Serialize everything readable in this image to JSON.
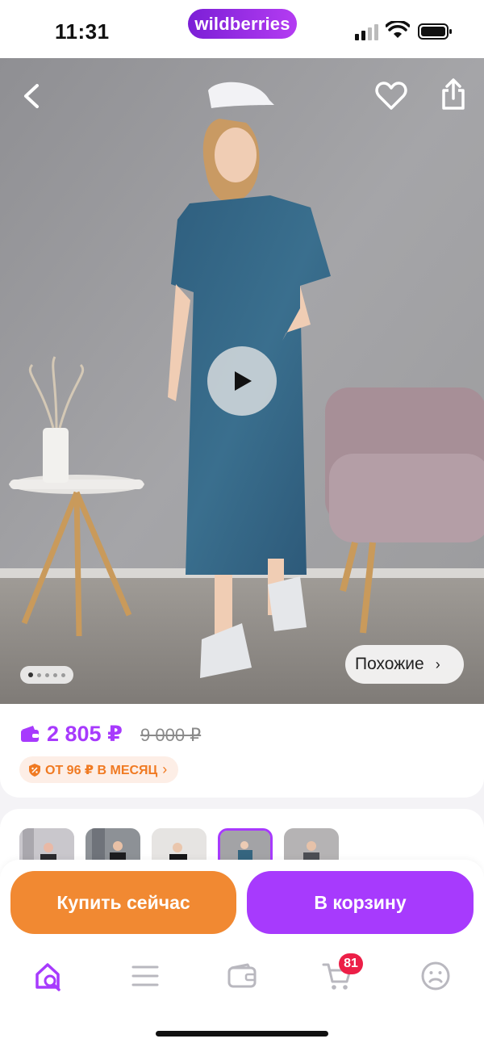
{
  "status_bar": {
    "time": "11:31",
    "brand": "wildberries"
  },
  "product": {
    "similar_label": "Похожие",
    "price": "2 805 ₽",
    "old_price": "9 000 ₽",
    "installment_label": "ОТ 96 ₽ В МЕСЯЦ",
    "gallery_count": 5,
    "gallery_active_index": 0,
    "thumbnails_selected_index": 3
  },
  "actions": {
    "buy_now": "Купить сейчас",
    "add_to_cart": "В корзину"
  },
  "tab_bar": {
    "cart_badge": "81",
    "items": [
      "home-search-icon",
      "menu-icon",
      "wallet-icon",
      "cart-icon",
      "profile-icon"
    ]
  },
  "colors": {
    "accent": "#a73afd",
    "buy_now": "#f18932",
    "badge": "#ec1f47",
    "installment_text": "#f07a22"
  }
}
